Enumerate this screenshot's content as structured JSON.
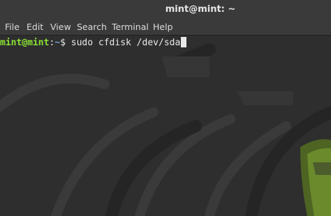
{
  "window": {
    "title": "mint@mint: ~"
  },
  "menu": {
    "items": [
      {
        "id": "file",
        "label": "File"
      },
      {
        "id": "edit",
        "label": "Edit"
      },
      {
        "id": "view",
        "label": "View"
      },
      {
        "id": "search",
        "label": "Search"
      },
      {
        "id": "terminal",
        "label": "Terminal"
      },
      {
        "id": "help",
        "label": "Help"
      }
    ]
  },
  "terminal": {
    "user_host": "mint@mint",
    "colon": ":",
    "path": "~",
    "symbol": "$ ",
    "command": "sudo cfdisk /dev/sda"
  },
  "colors": {
    "prompt_user": "#8ae234",
    "prompt_path": "#729fcf",
    "background": "#2e2e2e",
    "logo_green": "#6a8a2c"
  }
}
